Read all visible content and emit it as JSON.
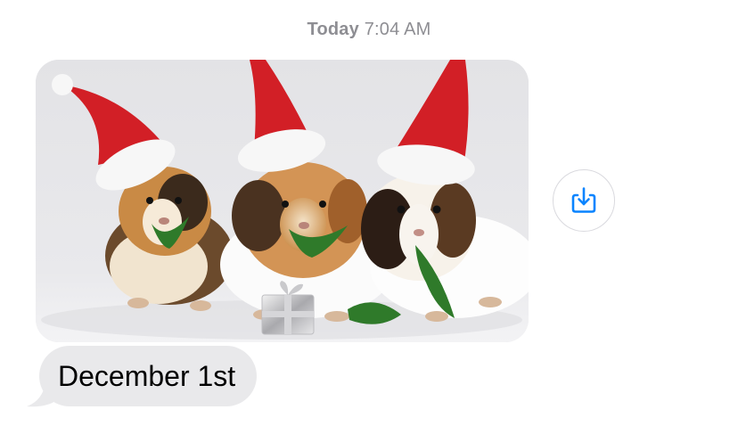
{
  "thread": {
    "timestamp_day": "Today",
    "timestamp_time": "7:04 AM"
  },
  "messages": [
    {
      "type": "image",
      "subject": "three guinea pigs wearing santa hats eating greens",
      "actions": {
        "save_icon": "download-to-tray-icon"
      }
    },
    {
      "type": "text",
      "text": "December 1st"
    }
  ],
  "colors": {
    "bubble_incoming": "#e9e9eb",
    "timestamp": "#8e8e93",
    "accent": "#0a84ff",
    "hat_red": "#d21f26"
  }
}
